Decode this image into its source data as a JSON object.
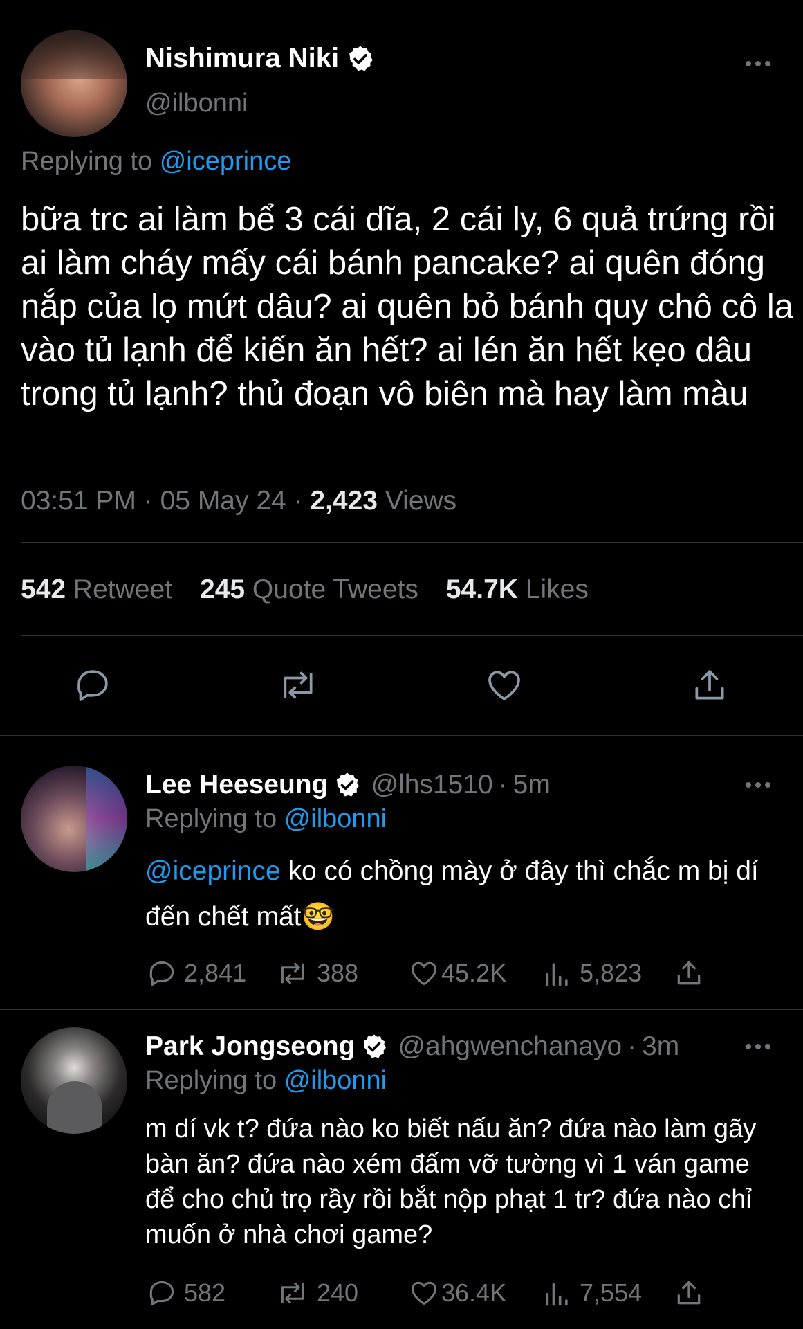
{
  "main_tweet": {
    "author_name": "Nishimura Niki",
    "handle": "@ilbonni",
    "replying_label": "Replying to",
    "replying_to": "@iceprince",
    "text": "bữa trc ai làm bể 3 cái dĩa, 2 cái ly, 6 quả trứng rồi ai làm cháy mấy cái bánh pancake? ai quên đóng nắp của lọ mứt dâu? ai quên bỏ bánh quy chô cô la vào tủ lạnh để kiến ăn hết? ai lén ăn hết kẹo dâu trong tủ lạnh? thủ đoạn vô biên mà hay làm màu",
    "time": "03:51 PM",
    "date": "05 May 24",
    "views_count": "2,423",
    "views_label": "Views",
    "retweets_count": "542",
    "retweets_label": "Retweet",
    "quotes_count": "245",
    "quotes_label": "Quote Tweets",
    "likes_count": "54.7K",
    "likes_label": "Likes"
  },
  "replies": [
    {
      "author_name": "Lee Heeseung",
      "handle": "@lhs1510",
      "age": "5m",
      "replying_label": "Replying to",
      "replying_to": "@ilbonni",
      "mention": "@iceprince",
      "text": "ko có chồng mày ở đây thì chắc m bị dí đến chết mất🤓",
      "replies": "2,841",
      "retweets": "388",
      "likes": "45.2K",
      "views": "5,823"
    },
    {
      "author_name": "Park Jongseong",
      "handle": "@ahgwenchanayo",
      "age": "3m",
      "replying_label": "Replying to",
      "replying_to": "@ilbonni",
      "text": "m dí vk t? đứa nào ko biết nấu ăn? đứa nào làm gãy bàn ăn? đứa nào xém đấm vỡ tường vì 1 ván game để cho chủ trọ rầy rồi bắt nộp phạt 1 tr? đứa nào chỉ muốn ở nhà chơi game?",
      "replies": "582",
      "retweets": "240",
      "likes": "36.4K",
      "views": "7,554"
    }
  ],
  "colors": {
    "background": "#000000",
    "text": "#e7e9ea",
    "muted": "#71767b",
    "accent": "#1d9bf0",
    "divider": "#2f3336"
  }
}
